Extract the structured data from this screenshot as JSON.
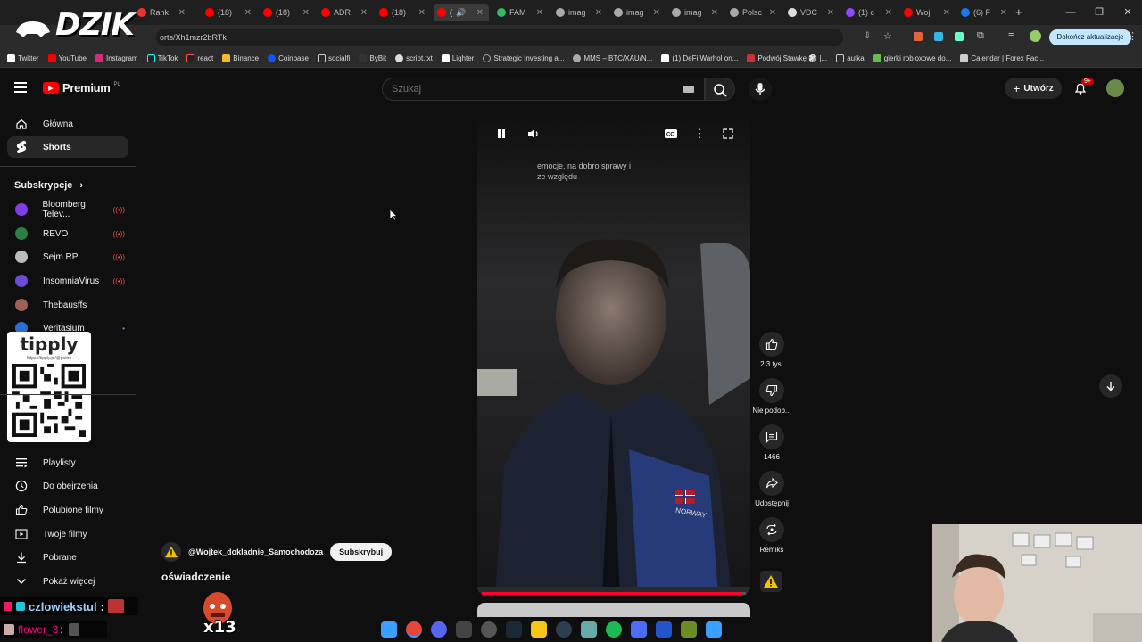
{
  "browser": {
    "tabs": [
      {
        "label": "Rank",
        "color": "#e33"
      },
      {
        "label": "(18)",
        "color": "#f00"
      },
      {
        "label": "(18)",
        "color": "#f00"
      },
      {
        "label": "ADR",
        "color": "#f00"
      },
      {
        "label": "(18)",
        "color": "#f00"
      },
      {
        "label": "(",
        "color": "#f00"
      },
      {
        "label": "FAM",
        "color": "#3b6"
      },
      {
        "label": "imag",
        "color": "#aaa"
      },
      {
        "label": "imag",
        "color": "#aaa"
      },
      {
        "label": "imag",
        "color": "#aaa"
      },
      {
        "label": "Polsc",
        "color": "#aaa"
      },
      {
        "label": "VDC",
        "color": "#ddd"
      },
      {
        "label": "(1) c",
        "color": "#9146ff"
      },
      {
        "label": "Woj",
        "color": "#f00"
      },
      {
        "label": "(6) F",
        "color": "#1877f2"
      }
    ],
    "url": "orts/Xh1mzr2bRTk",
    "update_label": "Dokończ aktualizacje",
    "bookmarks": [
      "Twitter",
      "YouTube",
      "Instagram",
      "TikTok",
      "react",
      "Binance",
      "Coinbase",
      "socialfi",
      "ByBit",
      "script.txt",
      "Lighter",
      "Strategic Investing a...",
      "MMS – BTC/XAU/N...",
      "(1) DeFi Warhol on...",
      "Podwój Stawkę 🎲 |...",
      "autka",
      "gierki robloxowe do...",
      "Calendar | Forex Fac..."
    ]
  },
  "overlay": {
    "logo": "DZIK",
    "tipply_title": "tipply",
    "tipply_url": "https://tipply.pl/@patiro",
    "chatter_name": "czlowiekstul",
    "chatter_sep": ":",
    "chatter2_name": "flower_3",
    "chatter2_sep": ":",
    "combo": "x13"
  },
  "youtube": {
    "logo": "Premium",
    "logo_region": "PL",
    "search_placeholder": "Szukaj",
    "create_label": "Utwórz",
    "notif_count": "9+"
  },
  "sidebar": {
    "nav": [
      {
        "label": "Główna",
        "icon": "home-icon"
      },
      {
        "label": "Shorts",
        "icon": "shorts-icon"
      }
    ],
    "subs_heading": "Subskrypcje",
    "subscriptions": [
      {
        "label": "Bloomberg Telev...",
        "live": "((•))",
        "color": "#7b3fe4"
      },
      {
        "label": "REVO",
        "live": "((•))",
        "color": "#2d7d46"
      },
      {
        "label": "Sejm RP",
        "live": "((•))",
        "color": "#bbb"
      },
      {
        "label": "InsomniaVirus",
        "live": "((•))",
        "color": "#6a4bd1"
      },
      {
        "label": "Thebausffs",
        "live": "",
        "color": "#a0605a"
      },
      {
        "label": "Veritasium",
        "live": "•",
        "color": "#2b6cd4"
      }
    ],
    "you_items": [
      {
        "label": "Playlisty",
        "icon": "playlist-icon"
      },
      {
        "label": "Do obejrzenia",
        "icon": "clock-icon"
      },
      {
        "label": "Polubione filmy",
        "icon": "thumbs-up-icon"
      },
      {
        "label": "Twoje filmy",
        "icon": "video-icon"
      },
      {
        "label": "Pobrane",
        "icon": "download-icon"
      },
      {
        "label": "Pokaż więcej",
        "icon": "chevron-down-icon"
      }
    ]
  },
  "short": {
    "caption": "emocje, na dobro sprawy i ze względu",
    "channel": "@Wojtek_dokladnie_Samochodoza",
    "subscribe_label": "Subskrybuj",
    "title": "oświadczenie",
    "progress": 0.98,
    "jacket_text": "NORWAY"
  },
  "actions": {
    "likes": "2,3 tys.",
    "dislike": "Nie podob...",
    "comments": "1466",
    "share": "Udostępnij",
    "remix": "Remiks"
  }
}
